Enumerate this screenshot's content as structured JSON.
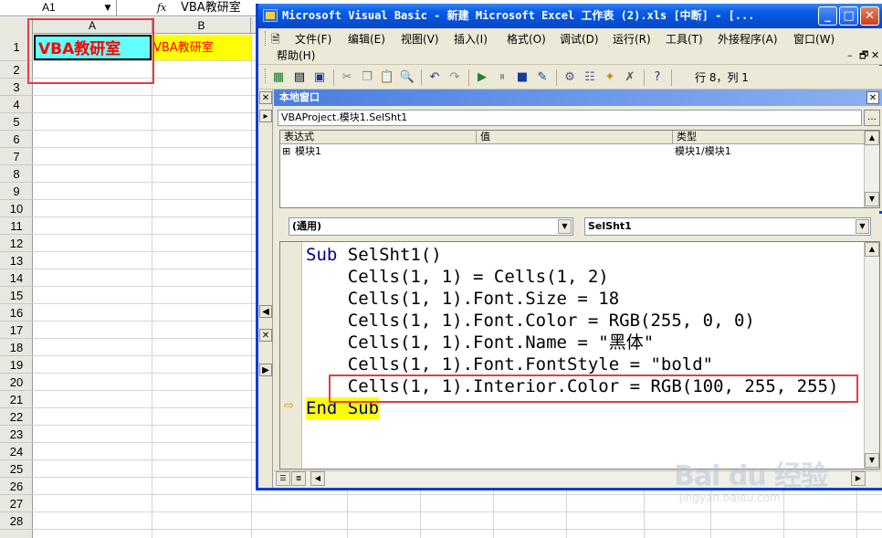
{
  "excel": {
    "name_box": "A1",
    "fx_label": "fx",
    "formula_value": "VBA教研室",
    "columns": [
      "A",
      "B"
    ],
    "rows": [
      "1",
      "2",
      "3",
      "4",
      "5",
      "6",
      "7",
      "8",
      "9",
      "10",
      "11",
      "12",
      "13",
      "14",
      "15",
      "16",
      "17",
      "18",
      "19",
      "20",
      "21",
      "22",
      "23",
      "24",
      "25",
      "26",
      "27",
      "28"
    ],
    "cell_a1": "VBA教研室",
    "cell_b1": "VBA教研室",
    "colors": {
      "cell_a1_fill": "#64ffff",
      "cell_a1_text": "#ff0000",
      "cell_b1_fill": "#ffff00",
      "cell_b1_text": "#ff0000",
      "highlight": "#e04040"
    }
  },
  "vba": {
    "title": "Microsoft Visual Basic - 新建 Microsoft Excel 工作表 (2).xls [中断] - [...",
    "title_buttons": {
      "minimize": "_",
      "maximize": "□",
      "close": "✕"
    },
    "menu": {
      "items": [
        "文件(F)",
        "编辑(E)",
        "视图(V)",
        "插入(I)",
        "格式(O)",
        "调试(D)",
        "运行(R)",
        "工具(T)",
        "外接程序(A)",
        "窗口(W)"
      ],
      "help": "帮助(H)",
      "right_controls": [
        "✕",
        "–",
        "🗗",
        "✕"
      ]
    },
    "toolbar": {
      "icons": [
        "excel-icon",
        "insert-module-icon",
        "save-icon",
        "cut-icon",
        "copy-icon",
        "paste-icon",
        "find-icon",
        "undo-icon",
        "redo-icon",
        "run-icon",
        "break-icon",
        "reset-icon",
        "design-mode-icon",
        "project-explorer-icon",
        "properties-icon",
        "object-browser-icon",
        "toolbox-icon",
        "help-icon"
      ],
      "position": "行 8，列 1"
    },
    "locals": {
      "title": "本地窗口",
      "context": "VBAProject.模块1.SelSht1",
      "headers": [
        "表达式",
        "值",
        "类型"
      ],
      "row": {
        "expression": "模块1",
        "value": "",
        "type": "模块1/模块1"
      }
    },
    "code": {
      "object_combo": "(通用)",
      "procedure_combo": "SelSht1",
      "lines": [
        "Sub SelSht1()",
        "    Cells(1, 1) = Cells(1, 2)",
        "    Cells(1, 1).Font.Size = 18",
        "    Cells(1, 1).Font.Color = RGB(255, 0, 0)",
        "    Cells(1, 1).Font.Name = \"黑体\"",
        "    Cells(1, 1).Font.FontStyle = \"bold\"",
        "    Cells(1, 1).Interior.Color = RGB(100, 255, 255)",
        "End Sub"
      ],
      "colors": {
        "keyword": "#00008b",
        "current_line": "#ffff00",
        "highlight": "#e04040"
      }
    }
  },
  "watermark": {
    "brand": "Bai du 经验",
    "url": "jingyan.baidu.com"
  }
}
